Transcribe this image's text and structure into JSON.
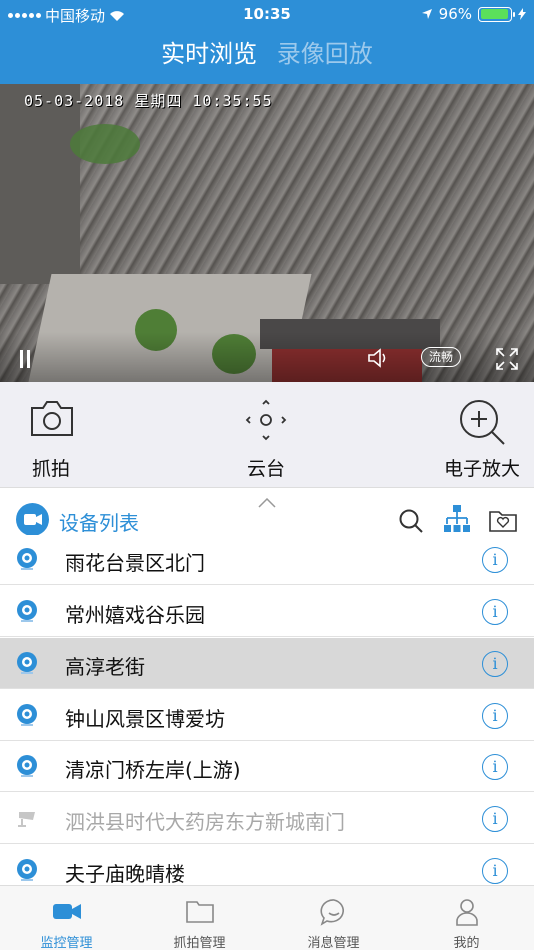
{
  "status_bar": {
    "carrier": "中国移动",
    "time": "10:35",
    "battery": "96%",
    "battery_level": 0.96
  },
  "header": {
    "tab_live": "实时浏览",
    "tab_playback": "录像回放"
  },
  "video": {
    "timestamp": "05-03-2018  星期四  10:35:55",
    "quality": "流畅"
  },
  "toolbar": {
    "snapshot": "抓拍",
    "ptz": "云台",
    "zoom": "电子放大"
  },
  "device_list": {
    "title": "设备列表",
    "items": [
      {
        "name": "雨花台景区北门",
        "status": "online"
      },
      {
        "name": "常州嬉戏谷乐园",
        "status": "online"
      },
      {
        "name": "高淳老街",
        "status": "selected"
      },
      {
        "name": "钟山风景区博爱坊",
        "status": "online"
      },
      {
        "name": "清凉门桥左岸(上游)",
        "status": "online"
      },
      {
        "name": "泗洪县时代大药房东方新城南门",
        "status": "offline"
      },
      {
        "name": "夫子庙晚晴楼",
        "status": "online"
      }
    ]
  },
  "bottom_nav": {
    "monitor": "监控管理",
    "capture": "抓拍管理",
    "message": "消息管理",
    "mine": "我的"
  },
  "colors": {
    "primary": "#2d8fd7",
    "toolbar_bg": "#efeff4",
    "selected_row": "#d8d8d8"
  }
}
